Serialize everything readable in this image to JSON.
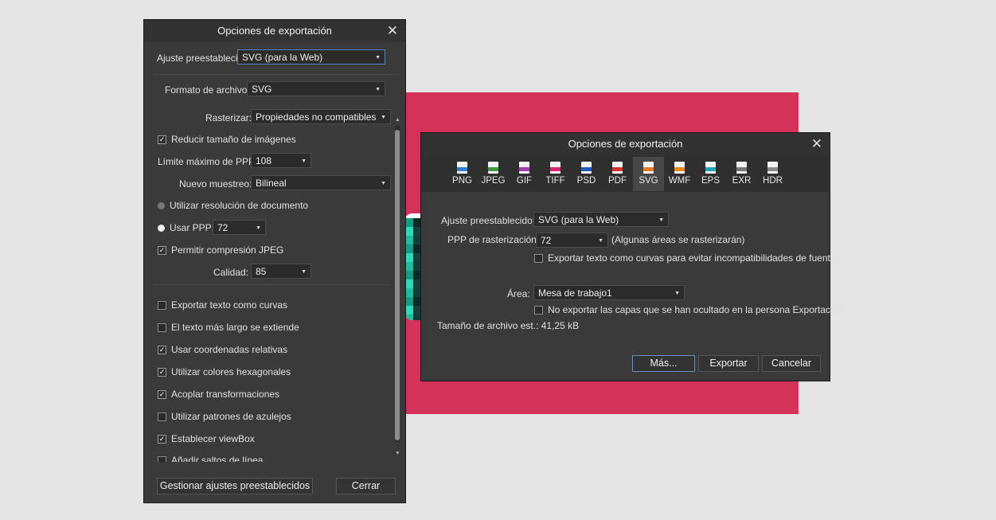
{
  "colors": {
    "accent": "#5b82b5",
    "canvas_bg": "#d4325a",
    "dialog_bg": "#3a3a3a"
  },
  "left_dialog": {
    "title": "Opciones de exportación",
    "preset_label": "Ajuste preestablecido:",
    "preset_value": "SVG (para la Web)",
    "format_label": "Formato de archivo:",
    "format_value": "SVG",
    "rasterize_label": "Rasterizar:",
    "rasterize_value": "Propiedades no compatibles",
    "reduce_images_label": "Reducir tamaño de imágenes",
    "max_ppp_label": "Límite máximo de PPP:",
    "max_ppp_value": "108",
    "resample_label": "Nuevo muestreo:",
    "resample_value": "Bilineal",
    "use_doc_res_label": "Utilizar resolución de documento",
    "use_ppp_label": "Usar PPP:",
    "use_ppp_value": "72",
    "jpeg_label": "Permitir compresión JPEG",
    "quality_label": "Calidad:",
    "quality_value": "85",
    "options": [
      {
        "label": "Exportar texto como curvas",
        "checked": false
      },
      {
        "label": "El texto más largo se extiende",
        "checked": false
      },
      {
        "label": "Usar coordenadas relativas",
        "checked": true
      },
      {
        "label": "Utilizar colores hexagonales",
        "checked": true
      },
      {
        "label": "Acoplar transformaciones",
        "checked": true
      },
      {
        "label": "Utilizar patrones de azulejos",
        "checked": false
      },
      {
        "label": "Establecer viewBox",
        "checked": true
      },
      {
        "label": "Añadir saltos de línea",
        "checked": false
      }
    ],
    "manage_presets_button": "Gestionar ajustes preestablecidos",
    "close_button": "Cerrar"
  },
  "right_dialog": {
    "title": "Opciones de exportación",
    "tabs": [
      {
        "label": "PNG",
        "badge": "PNG",
        "color": "#2f7fd8"
      },
      {
        "label": "JPEG",
        "badge": "JPEG",
        "color": "#3c9a3c"
      },
      {
        "label": "GIF",
        "badge": "GIF",
        "color": "#a23bb0"
      },
      {
        "label": "TIFF",
        "badge": "TIFF",
        "color": "#d6246e"
      },
      {
        "label": "PSD",
        "badge": "PSD",
        "color": "#2357b8"
      },
      {
        "label": "PDF",
        "badge": "PDF",
        "color": "#d43030"
      },
      {
        "label": "SVG",
        "badge": "SVG",
        "color": "#e77a1e"
      },
      {
        "label": "WMF",
        "badge": "WMF",
        "color": "#e68a1e"
      },
      {
        "label": "EPS",
        "badge": "EPS",
        "color": "#22a3b8"
      },
      {
        "label": "EXR",
        "badge": "EXR",
        "color": "#777777"
      },
      {
        "label": "HDR",
        "badge": "HDR",
        "color": "#8a8a8a"
      }
    ],
    "active_tab": "SVG",
    "preset_label": "Ajuste preestablecido:",
    "preset_value": "SVG (para la Web)",
    "raster_ppp_label": "PPP de rasterización:",
    "raster_ppp_value": "72",
    "raster_note": "(Algunas áreas se rasterizarán)",
    "text_curves_label": "Exportar texto como curvas para evitar incompatibilidades de fuentes",
    "area_label": "Área:",
    "area_value": "Mesa de trabajo1",
    "hidden_layers_label": "No exportar las capas que se han ocultado en la persona Exportación",
    "file_size_label": "Tamaño de archivo est.:",
    "file_size_value": "41,25 kB",
    "more_button": "Más...",
    "export_button": "Exportar",
    "cancel_button": "Cancelar"
  }
}
